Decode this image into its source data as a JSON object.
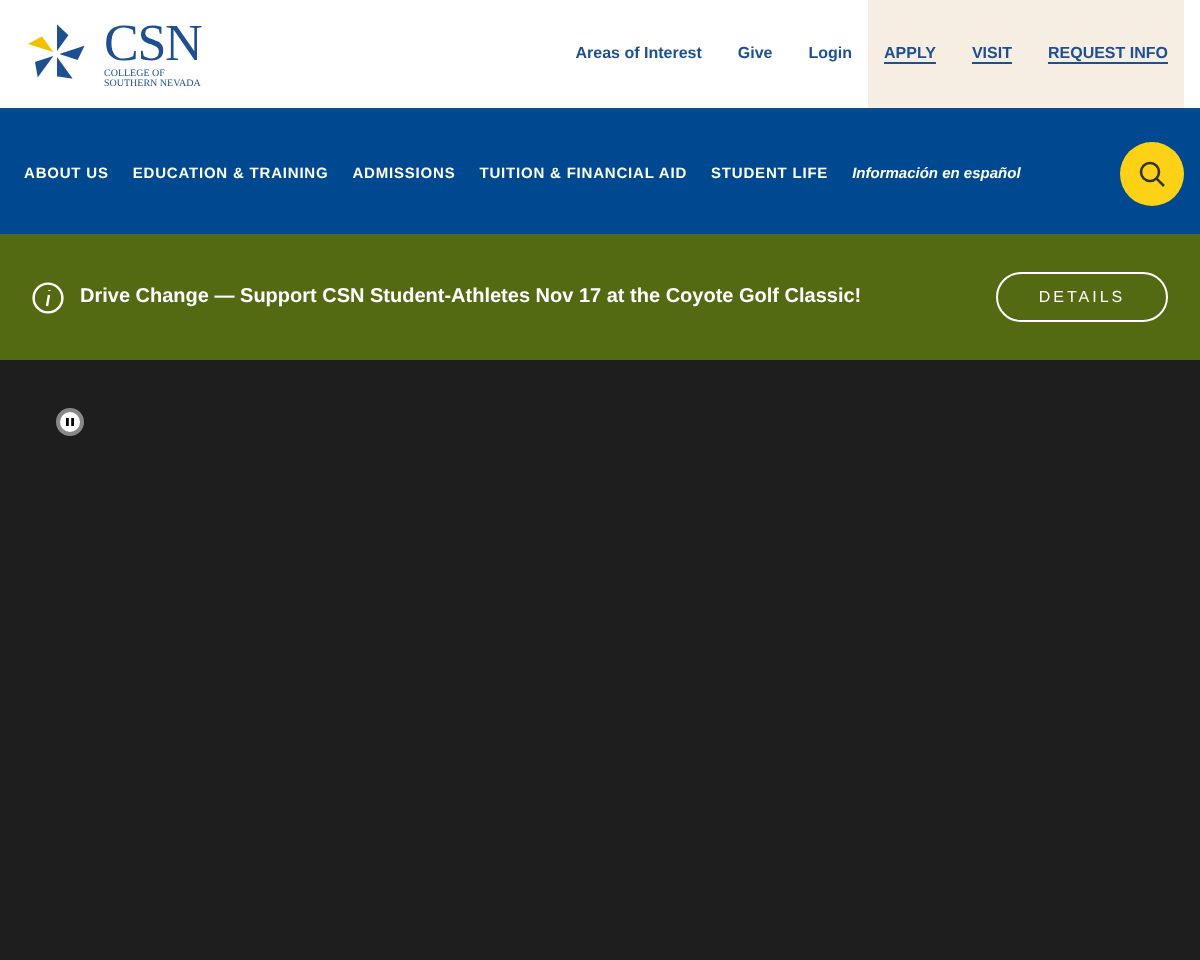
{
  "logo": {
    "name": "CSN",
    "subtitle_lines": [
      "COLLEGE OF",
      "SOUTHERN NEVADA"
    ]
  },
  "utility_links": [
    {
      "label": "Areas of Interest",
      "kind": "plain"
    },
    {
      "label": "Give",
      "kind": "plain"
    },
    {
      "label": "Login",
      "kind": "plain"
    },
    {
      "label": "APPLY",
      "kind": "cta"
    },
    {
      "label": "VISIT",
      "kind": "cta"
    },
    {
      "label": "REQUEST INFO",
      "kind": "cta"
    }
  ],
  "main_nav": [
    {
      "label": "ABOUT US",
      "kind": "section"
    },
    {
      "label": "EDUCATION & TRAINING",
      "kind": "section"
    },
    {
      "label": "ADMISSIONS",
      "kind": "section"
    },
    {
      "label": "TUITION & FINANCIAL AID",
      "kind": "section"
    },
    {
      "label": "STUDENT LIFE",
      "kind": "section"
    },
    {
      "label": "Información en español",
      "kind": "language"
    }
  ],
  "alert": {
    "message": "Drive Change — Support CSN Student-Athletes Nov 17 at the Coyote Golf Classic!",
    "button": "DETAILS"
  },
  "hero": {
    "paused": false
  }
}
